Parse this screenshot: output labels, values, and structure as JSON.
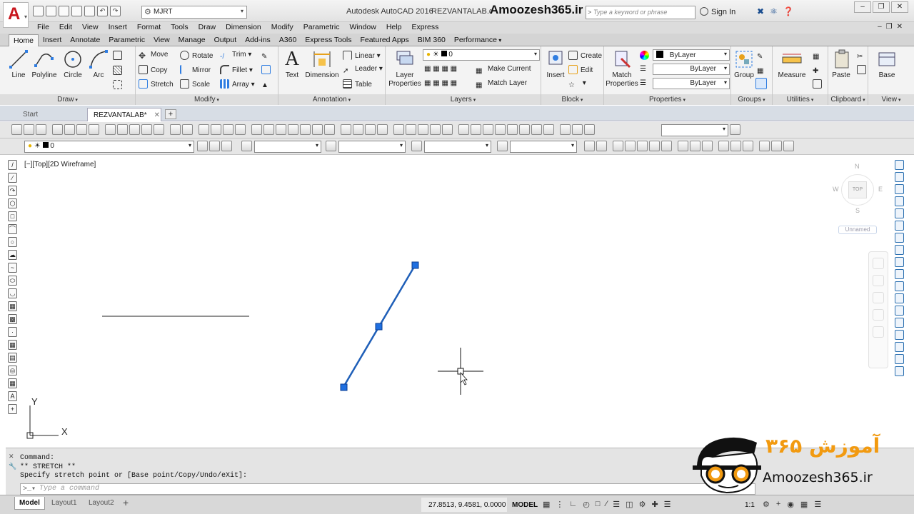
{
  "titlebar": {
    "workspace": "MJRT",
    "app_title": "Autodesk AutoCAD 2016",
    "doc_title": "REZVANTALAB.dwg",
    "watermark": "Amoozesh365.ir",
    "search_placeholder": "Type a keyword or phrase",
    "sign_in": "Sign In"
  },
  "menu": [
    "File",
    "Edit",
    "View",
    "Insert",
    "Format",
    "Tools",
    "Draw",
    "Dimension",
    "Modify",
    "Parametric",
    "Window",
    "Help",
    "Express"
  ],
  "ribbon_tabs": [
    "Home",
    "Insert",
    "Annotate",
    "Parametric",
    "View",
    "Manage",
    "Output",
    "Add-ins",
    "A360",
    "Express Tools",
    "Featured Apps",
    "BIM 360",
    "Performance"
  ],
  "ribbon": {
    "draw": {
      "title": "Draw",
      "line": "Line",
      "polyline": "Polyline",
      "circle": "Circle",
      "arc": "Arc"
    },
    "modify": {
      "title": "Modify",
      "move": "Move",
      "rotate": "Rotate",
      "trim": "Trim",
      "copy": "Copy",
      "mirror": "Mirror",
      "fillet": "Fillet",
      "stretch": "Stretch",
      "scale": "Scale",
      "array": "Array"
    },
    "annotation": {
      "title": "Annotation",
      "text": "Text",
      "dimension": "Dimension",
      "linear": "Linear",
      "leader": "Leader",
      "table": "Table"
    },
    "layers": {
      "title": "Layers",
      "layer_properties": "Layer Properties",
      "current_layer": "0",
      "make_current": "Make Current",
      "match_layer": "Match Layer"
    },
    "block": {
      "title": "Block",
      "insert": "Insert",
      "create": "Create",
      "edit": "Edit"
    },
    "properties": {
      "title": "Properties",
      "match_properties": "Match Properties",
      "color": "ByLayer",
      "linetype": "ByLayer",
      "lineweight": "ByLayer"
    },
    "groups": {
      "title": "Groups",
      "group": "Group"
    },
    "utilities": {
      "title": "Utilities",
      "measure": "Measure"
    },
    "clipboard": {
      "title": "Clipboard",
      "paste": "Paste"
    },
    "view": {
      "title": "View",
      "base": "Base"
    }
  },
  "doc_tabs": {
    "start": "Start",
    "active": "REZVANTALAB*"
  },
  "toolbar2": {
    "layer": "0"
  },
  "viewport": {
    "label": "[−][Top][2D Wireframe]",
    "compass_n": "N",
    "compass_w": "W",
    "compass_e": "E",
    "compass_s": "S",
    "cube_face": "TOP",
    "ucs_name": "Unnamed"
  },
  "ucs": {
    "x": "X",
    "y": "Y"
  },
  "command": {
    "history": [
      "Command:",
      "** STRETCH **",
      "Specify stretch point or [Base point/Copy/Undo/eXit]:"
    ],
    "input_placeholder": "Type a command"
  },
  "status": {
    "layout_tabs": [
      "Model",
      "Layout1",
      "Layout2"
    ],
    "coords": "27.8513, 9.4581, 0.0000",
    "space": "MODEL",
    "scale": "1:1"
  },
  "brand": {
    "url": "Amoozesh365.ir",
    "fa_text": "آموزش ۳۶۵"
  },
  "colors": {
    "grip": "#1f6fe0",
    "selected_line": "#1f5fb8",
    "brand_orange": "#f29a10",
    "autocad_red": "#c8161d"
  }
}
